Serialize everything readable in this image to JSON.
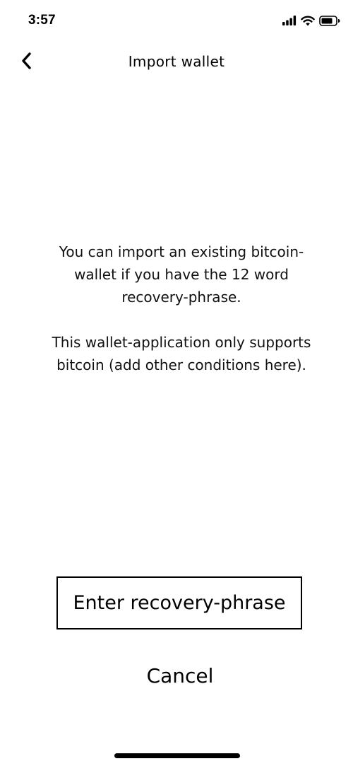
{
  "status_bar": {
    "time": "3:57",
    "icons": [
      "cellular-signal-icon",
      "wifi-icon",
      "battery-icon"
    ]
  },
  "nav": {
    "title": "Import wallet",
    "back_icon": "chevron-left-icon"
  },
  "intro": {
    "paragraph_1": "You can import an existing bitcoin-wallet if you have the 12 word recovery-phrase.",
    "paragraph_2": "This wallet-application only supports bitcoin (add other conditions here)."
  },
  "actions": {
    "primary_label": "Enter recovery-phrase",
    "cancel_label": "Cancel"
  }
}
